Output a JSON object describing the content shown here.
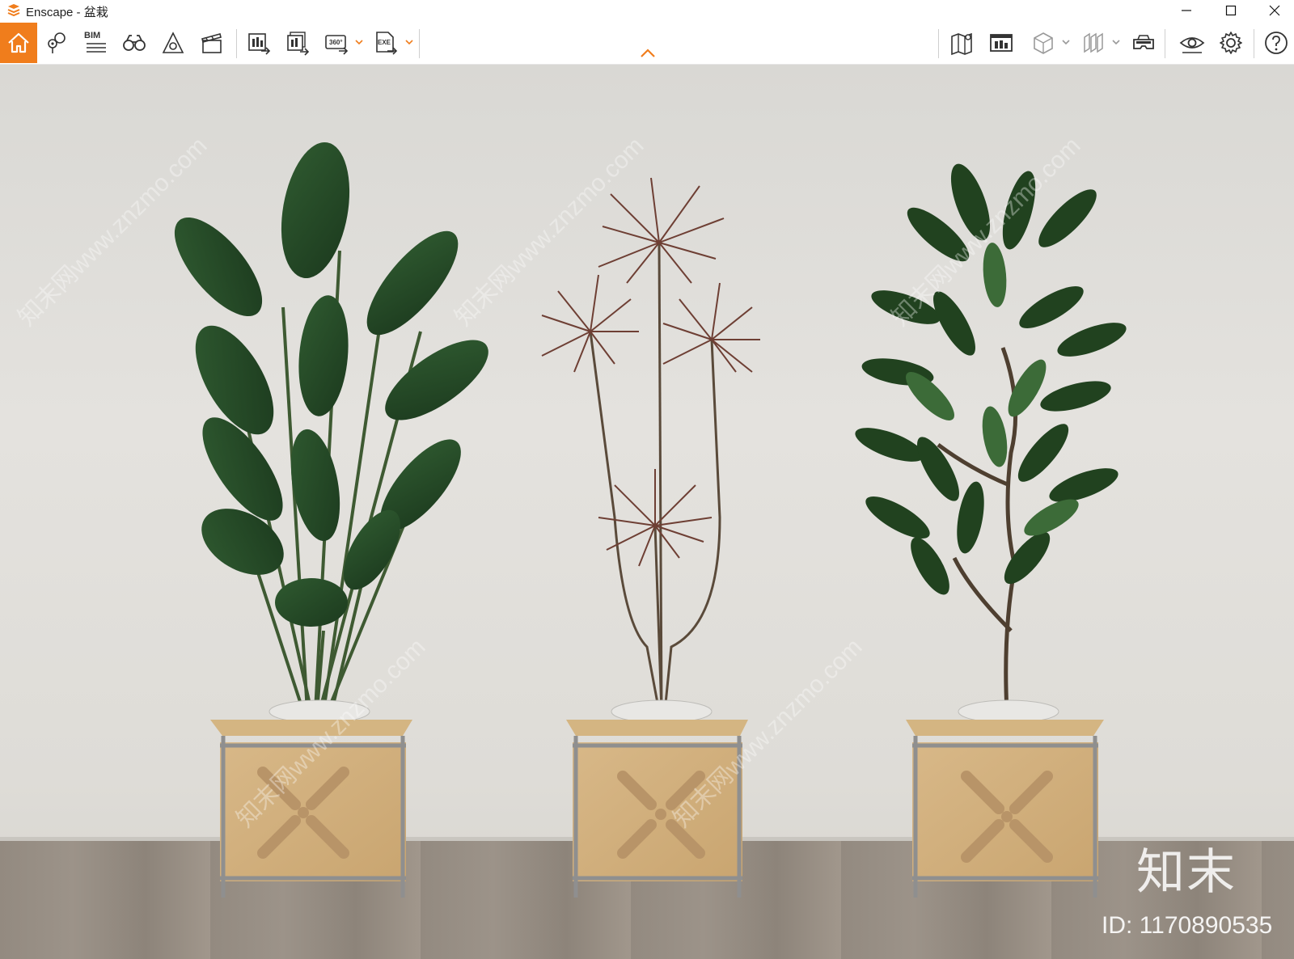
{
  "window": {
    "app_name": "Enscape",
    "separator": " - ",
    "document": "盆栽",
    "controls": [
      "minimize",
      "maximize",
      "close"
    ]
  },
  "toolbar": {
    "left_tools": [
      {
        "name": "home-icon",
        "active": true
      },
      {
        "name": "location-pins-icon"
      },
      {
        "name": "bim-icon",
        "label": "BIM"
      },
      {
        "name": "binoculars-icon"
      },
      {
        "name": "reference-cone-icon"
      },
      {
        "name": "clapperboard-icon"
      },
      {
        "name": "render-screenshot-icon"
      },
      {
        "name": "batch-render-icon"
      },
      {
        "name": "panorama-360-icon",
        "label": "360°",
        "dropdown": true
      },
      {
        "name": "export-exe-icon",
        "label": "EXE",
        "dropdown": true
      }
    ],
    "right_tools": [
      {
        "name": "map-icon"
      },
      {
        "name": "asset-library-icon"
      },
      {
        "name": "material-cube-icon",
        "dropdown": true
      },
      {
        "name": "section-planes-icon",
        "dropdown": true
      },
      {
        "name": "vr-headset-icon"
      },
      {
        "name": "visual-settings-eye-icon"
      },
      {
        "name": "settings-gear-icon"
      },
      {
        "name": "help-icon"
      }
    ],
    "accent_color": "#f07d1c"
  },
  "viewport": {
    "scene": "three potted plants on plywood stands",
    "watermark": {
      "brand": "知末",
      "id": "ID: 1170890535",
      "diagonal_text": "知末网www.znzmo.com"
    }
  }
}
